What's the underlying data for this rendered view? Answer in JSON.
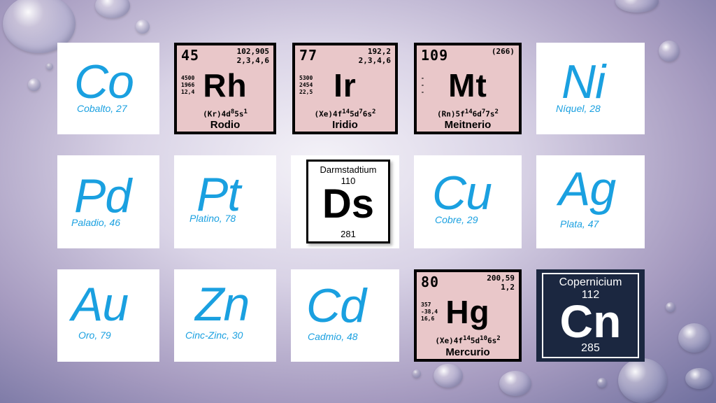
{
  "elements": {
    "co": {
      "symbol": "Co",
      "caption": "Cobalto, 27"
    },
    "ni": {
      "symbol": "Ni",
      "caption": "Níquel, 28"
    },
    "pd": {
      "symbol": "Pd",
      "caption": "Paladio, 46"
    },
    "pt": {
      "symbol": "Pt",
      "caption": "Platino, 78"
    },
    "cu": {
      "symbol": "Cu",
      "caption": "Cobre, 29"
    },
    "ag": {
      "symbol": "Ag",
      "caption": "Plata, 47"
    },
    "au": {
      "symbol": "Au",
      "caption": "Oro, 79"
    },
    "zn": {
      "symbol": "Zn",
      "caption": "Cinc-Zinc, 30"
    },
    "cd": {
      "symbol": "Cd",
      "caption": "Cadmio, 48"
    }
  },
  "cards": {
    "rh": {
      "number": "45",
      "mass": "102,905",
      "oxidation": "2,3,4,6",
      "props": [
        "4500",
        "1966",
        "12,4"
      ],
      "symbol": "Rh",
      "config_base": "(Kr)4d",
      "config_sup1": "8",
      "config_mid": "5s",
      "config_sup2": "1",
      "name": "Rodio"
    },
    "ir": {
      "number": "77",
      "mass": "192,2",
      "oxidation": "2,3,4,6",
      "props": [
        "5300",
        "2454",
        "22,5"
      ],
      "symbol": "Ir",
      "config_base": "(Xe)4f",
      "config_sup1": "14",
      "config_mid": "5d",
      "config_sup2": "7",
      "config_end": "6s",
      "config_sup3": "2",
      "name": "Iridio"
    },
    "mt": {
      "number": "109",
      "mass": "(266)",
      "props": [
        "-",
        "-",
        "-"
      ],
      "symbol": "Mt",
      "config_base": "(Rn)5f",
      "config_sup1": "14",
      "config_mid": "6d",
      "config_sup2": "7",
      "config_end": "7s",
      "config_sup3": "2",
      "name": "Meitnerio"
    },
    "hg": {
      "number": "80",
      "mass": "200,59",
      "oxidation": "1,2",
      "props": [
        "357",
        "-38,4",
        "16,6"
      ],
      "symbol": "Hg",
      "config_base": "(Xe)4f",
      "config_sup1": "14",
      "config_mid": "5d",
      "config_sup2": "10",
      "config_end": "6s",
      "config_sup3": "2",
      "name": "Mercurio"
    },
    "ds": {
      "name": "Darmstadtium",
      "number": "110",
      "symbol": "Ds",
      "mass": "281"
    },
    "cn": {
      "name": "Copernicium",
      "number": "112",
      "symbol": "Cn",
      "mass": "285"
    }
  },
  "colors": {
    "accent": "#1aa0e0",
    "card_pink": "#e9c7c9",
    "card_navy": "#1b2740"
  }
}
